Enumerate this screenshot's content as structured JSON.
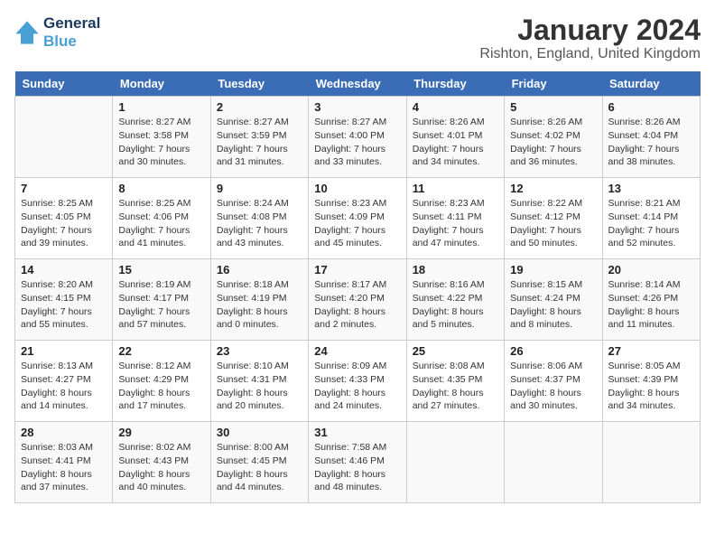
{
  "logo": {
    "line1": "General",
    "line2": "Blue"
  },
  "title": "January 2024",
  "subtitle": "Rishton, England, United Kingdom",
  "days_of_week": [
    "Sunday",
    "Monday",
    "Tuesday",
    "Wednesday",
    "Thursday",
    "Friday",
    "Saturday"
  ],
  "weeks": [
    [
      {
        "day": "",
        "sunrise": "",
        "sunset": "",
        "daylight": "",
        "empty": true
      },
      {
        "day": "1",
        "sunrise": "Sunrise: 8:27 AM",
        "sunset": "Sunset: 3:58 PM",
        "daylight": "Daylight: 7 hours and 30 minutes."
      },
      {
        "day": "2",
        "sunrise": "Sunrise: 8:27 AM",
        "sunset": "Sunset: 3:59 PM",
        "daylight": "Daylight: 7 hours and 31 minutes."
      },
      {
        "day": "3",
        "sunrise": "Sunrise: 8:27 AM",
        "sunset": "Sunset: 4:00 PM",
        "daylight": "Daylight: 7 hours and 33 minutes."
      },
      {
        "day": "4",
        "sunrise": "Sunrise: 8:26 AM",
        "sunset": "Sunset: 4:01 PM",
        "daylight": "Daylight: 7 hours and 34 minutes."
      },
      {
        "day": "5",
        "sunrise": "Sunrise: 8:26 AM",
        "sunset": "Sunset: 4:02 PM",
        "daylight": "Daylight: 7 hours and 36 minutes."
      },
      {
        "day": "6",
        "sunrise": "Sunrise: 8:26 AM",
        "sunset": "Sunset: 4:04 PM",
        "daylight": "Daylight: 7 hours and 38 minutes."
      }
    ],
    [
      {
        "day": "7",
        "sunrise": "Sunrise: 8:25 AM",
        "sunset": "Sunset: 4:05 PM",
        "daylight": "Daylight: 7 hours and 39 minutes."
      },
      {
        "day": "8",
        "sunrise": "Sunrise: 8:25 AM",
        "sunset": "Sunset: 4:06 PM",
        "daylight": "Daylight: 7 hours and 41 minutes."
      },
      {
        "day": "9",
        "sunrise": "Sunrise: 8:24 AM",
        "sunset": "Sunset: 4:08 PM",
        "daylight": "Daylight: 7 hours and 43 minutes."
      },
      {
        "day": "10",
        "sunrise": "Sunrise: 8:23 AM",
        "sunset": "Sunset: 4:09 PM",
        "daylight": "Daylight: 7 hours and 45 minutes."
      },
      {
        "day": "11",
        "sunrise": "Sunrise: 8:23 AM",
        "sunset": "Sunset: 4:11 PM",
        "daylight": "Daylight: 7 hours and 47 minutes."
      },
      {
        "day": "12",
        "sunrise": "Sunrise: 8:22 AM",
        "sunset": "Sunset: 4:12 PM",
        "daylight": "Daylight: 7 hours and 50 minutes."
      },
      {
        "day": "13",
        "sunrise": "Sunrise: 8:21 AM",
        "sunset": "Sunset: 4:14 PM",
        "daylight": "Daylight: 7 hours and 52 minutes."
      }
    ],
    [
      {
        "day": "14",
        "sunrise": "Sunrise: 8:20 AM",
        "sunset": "Sunset: 4:15 PM",
        "daylight": "Daylight: 7 hours and 55 minutes."
      },
      {
        "day": "15",
        "sunrise": "Sunrise: 8:19 AM",
        "sunset": "Sunset: 4:17 PM",
        "daylight": "Daylight: 7 hours and 57 minutes."
      },
      {
        "day": "16",
        "sunrise": "Sunrise: 8:18 AM",
        "sunset": "Sunset: 4:19 PM",
        "daylight": "Daylight: 8 hours and 0 minutes."
      },
      {
        "day": "17",
        "sunrise": "Sunrise: 8:17 AM",
        "sunset": "Sunset: 4:20 PM",
        "daylight": "Daylight: 8 hours and 2 minutes."
      },
      {
        "day": "18",
        "sunrise": "Sunrise: 8:16 AM",
        "sunset": "Sunset: 4:22 PM",
        "daylight": "Daylight: 8 hours and 5 minutes."
      },
      {
        "day": "19",
        "sunrise": "Sunrise: 8:15 AM",
        "sunset": "Sunset: 4:24 PM",
        "daylight": "Daylight: 8 hours and 8 minutes."
      },
      {
        "day": "20",
        "sunrise": "Sunrise: 8:14 AM",
        "sunset": "Sunset: 4:26 PM",
        "daylight": "Daylight: 8 hours and 11 minutes."
      }
    ],
    [
      {
        "day": "21",
        "sunrise": "Sunrise: 8:13 AM",
        "sunset": "Sunset: 4:27 PM",
        "daylight": "Daylight: 8 hours and 14 minutes."
      },
      {
        "day": "22",
        "sunrise": "Sunrise: 8:12 AM",
        "sunset": "Sunset: 4:29 PM",
        "daylight": "Daylight: 8 hours and 17 minutes."
      },
      {
        "day": "23",
        "sunrise": "Sunrise: 8:10 AM",
        "sunset": "Sunset: 4:31 PM",
        "daylight": "Daylight: 8 hours and 20 minutes."
      },
      {
        "day": "24",
        "sunrise": "Sunrise: 8:09 AM",
        "sunset": "Sunset: 4:33 PM",
        "daylight": "Daylight: 8 hours and 24 minutes."
      },
      {
        "day": "25",
        "sunrise": "Sunrise: 8:08 AM",
        "sunset": "Sunset: 4:35 PM",
        "daylight": "Daylight: 8 hours and 27 minutes."
      },
      {
        "day": "26",
        "sunrise": "Sunrise: 8:06 AM",
        "sunset": "Sunset: 4:37 PM",
        "daylight": "Daylight: 8 hours and 30 minutes."
      },
      {
        "day": "27",
        "sunrise": "Sunrise: 8:05 AM",
        "sunset": "Sunset: 4:39 PM",
        "daylight": "Daylight: 8 hours and 34 minutes."
      }
    ],
    [
      {
        "day": "28",
        "sunrise": "Sunrise: 8:03 AM",
        "sunset": "Sunset: 4:41 PM",
        "daylight": "Daylight: 8 hours and 37 minutes."
      },
      {
        "day": "29",
        "sunrise": "Sunrise: 8:02 AM",
        "sunset": "Sunset: 4:43 PM",
        "daylight": "Daylight: 8 hours and 40 minutes."
      },
      {
        "day": "30",
        "sunrise": "Sunrise: 8:00 AM",
        "sunset": "Sunset: 4:45 PM",
        "daylight": "Daylight: 8 hours and 44 minutes."
      },
      {
        "day": "31",
        "sunrise": "Sunrise: 7:58 AM",
        "sunset": "Sunset: 4:46 PM",
        "daylight": "Daylight: 8 hours and 48 minutes."
      },
      {
        "day": "",
        "sunrise": "",
        "sunset": "",
        "daylight": "",
        "empty": true
      },
      {
        "day": "",
        "sunrise": "",
        "sunset": "",
        "daylight": "",
        "empty": true
      },
      {
        "day": "",
        "sunrise": "",
        "sunset": "",
        "daylight": "",
        "empty": true
      }
    ]
  ]
}
